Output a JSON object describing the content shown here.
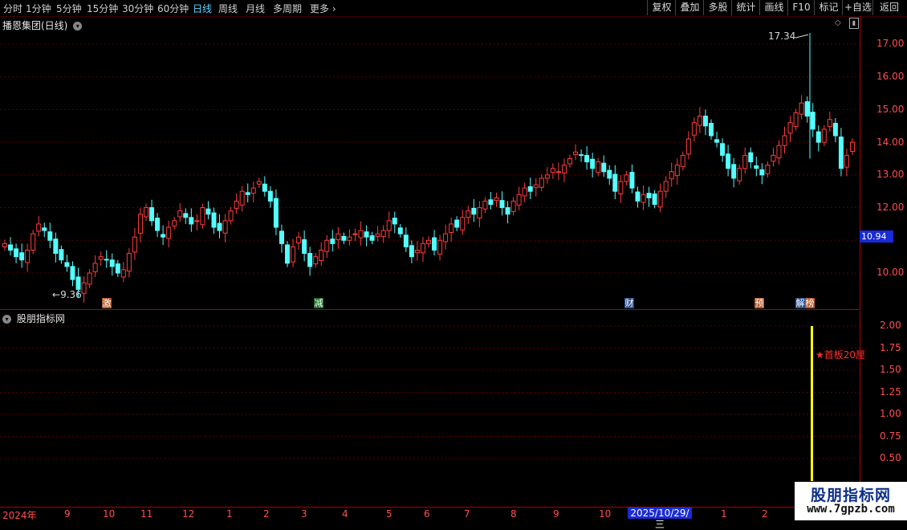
{
  "toolbar": {
    "periods": [
      "分时",
      "1分钟",
      "5分钟",
      "15分钟",
      "30分钟",
      "60分钟",
      "日线",
      "周线",
      "月线",
      "多周期",
      "更多"
    ],
    "active_period": "日线",
    "buttons": [
      "复权",
      "叠加",
      "多股",
      "统计",
      "画线",
      "F10",
      "标记",
      "+自选",
      "返回"
    ]
  },
  "main_chart": {
    "title": "播恩集团(日线)",
    "y_ticks": [
      "17.00",
      "16.00",
      "15.00",
      "14.00",
      "13.00",
      "12.00",
      "10.00"
    ],
    "current_price": "10.94",
    "high_label": "17.34",
    "low_label": "9.36",
    "events": [
      "激",
      "减",
      "财",
      "预",
      "解",
      "榜"
    ]
  },
  "indicator": {
    "title": "股朋指标网",
    "y_ticks": [
      "2.00",
      "1.75",
      "1.50",
      "1.25",
      "1.00",
      "0.75",
      "0.50"
    ],
    "signal_label": "★首板20厘",
    "signal_value": 2.0
  },
  "x_axis": {
    "labels": [
      "2024年",
      "9",
      "10",
      "11",
      "12",
      "1",
      "2",
      "3",
      "4",
      "5",
      "6",
      "7",
      "8",
      "9",
      "10",
      "1",
      "2"
    ],
    "cursor_date": "2025/10/29/三"
  },
  "watermark": {
    "line1": "股朋指标网",
    "line2": "www.7gpzb.com"
  },
  "colors": {
    "up": "#ff3c3c",
    "down": "#54ffff",
    "axis": "#b00000",
    "signal": "#ffff00",
    "cursor_box": "#1a2bd8"
  },
  "chart_data": {
    "type": "candlestick",
    "ylim": [
      9.3,
      17.5
    ],
    "values_close": [
      10.9,
      10.7,
      10.5,
      10.4,
      10.7,
      11.2,
      11.5,
      11.3,
      11.0,
      10.6,
      10.4,
      10.2,
      9.8,
      9.5,
      9.7,
      10.0,
      10.3,
      10.5,
      10.4,
      10.2,
      10.0,
      10.1,
      10.6,
      11.1,
      11.8,
      12.0,
      11.6,
      11.3,
      11.1,
      11.4,
      11.6,
      11.9,
      11.7,
      11.5,
      11.6,
      12.0,
      11.8,
      11.4,
      11.3,
      11.6,
      11.9,
      12.2,
      12.5,
      12.4,
      12.6,
      12.8,
      12.5,
      12.2,
      11.4,
      10.9,
      10.3,
      10.8,
      11.1,
      10.6,
      10.2,
      10.5,
      10.7,
      11.0,
      10.9,
      11.2,
      11.0,
      11.1,
      11.2,
      11.3,
      11.1,
      11.0,
      11.2,
      11.3,
      11.6,
      11.5,
      11.2,
      10.8,
      10.5,
      10.7,
      10.9,
      11.0,
      10.7,
      11.0,
      11.2,
      11.5,
      11.4,
      11.7,
      11.9,
      11.8,
      12.0,
      12.2,
      12.1,
      12.3,
      12.0,
      11.8,
      12.2,
      12.4,
      12.6,
      12.5,
      12.7,
      12.9,
      13.0,
      13.2,
      13.1,
      13.3,
      13.5,
      13.7,
      13.6,
      13.4,
      13.2,
      13.4,
      13.1,
      12.9,
      12.5,
      12.8,
      13.0,
      12.6,
      12.2,
      12.4,
      12.3,
      12.1,
      12.5,
      12.8,
      13.1,
      13.3,
      13.6,
      14.1,
      14.6,
      14.8,
      14.5,
      14.2,
      14.0,
      13.6,
      13.2,
      12.9,
      13.2,
      13.6,
      13.4,
      13.2,
      13.0,
      13.3,
      13.6,
      13.9,
      14.2,
      14.6,
      14.9,
      15.2,
      14.8,
      14.4,
      14.0,
      14.4,
      14.7,
      14.2,
      13.2,
      13.6,
      14.0
    ],
    "high": 17.34,
    "low": 9.36,
    "last": 10.94,
    "indicator_series": {
      "name": "首板20厘",
      "value": 2.0
    }
  }
}
